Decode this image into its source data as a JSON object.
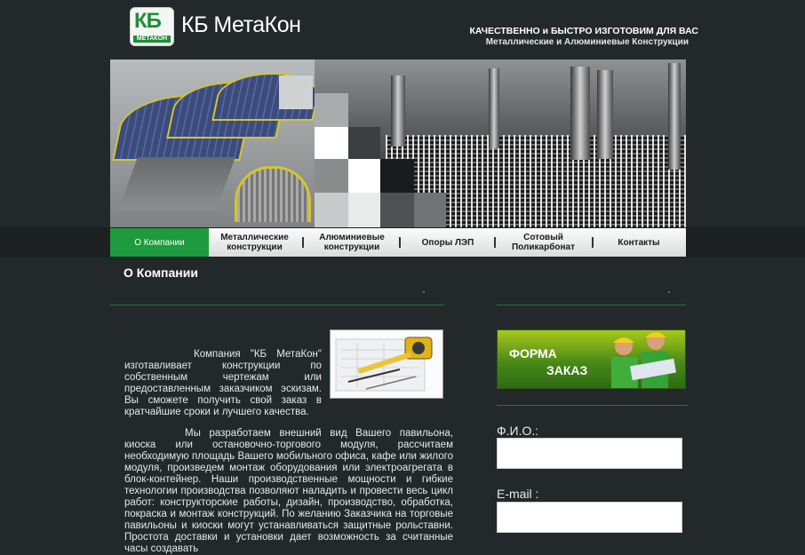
{
  "header": {
    "logo_letters": "КБ",
    "logo_subtext": "МЕТАКОН",
    "company_name": "КБ МетаКон",
    "tagline_line1": "КАЧЕСТВЕННО и БЫСТРО ИЗГОТОВИМ ДЛЯ ВАС",
    "tagline_line2": "Металлические и Алюминиевые Конструкции"
  },
  "nav": {
    "items": [
      {
        "label": "О Компании",
        "active": true
      },
      {
        "label": "Металлические конструкции",
        "active": false
      },
      {
        "label": "Алюминиевые конструкции",
        "active": false
      },
      {
        "label": "Опоры ЛЭП",
        "active": false
      },
      {
        "label": "Сотовый Поликарбонат",
        "active": false
      },
      {
        "label": "Контакты",
        "active": false
      }
    ]
  },
  "main": {
    "page_title": "О Компании",
    "paragraph1": "Компания \"КБ МетаКон\" изготавливает конструкции по собственным чертежам или предоставленным заказчиком эскизам. Вы сможете получить свой заказ в кратчайшие сроки и лучшего качества.",
    "paragraph2": "Мы разработаем внешний вид Вашего павильона, киоска или остановочно-торгового модуля, рассчитаем необходимую площадь Вашего мобильного офиса, кафе или жилого модуля, произведем монтаж оборудования или электроагрегата в блок-контейнер. Наши производственные мощности и гибкие технологии производства позволяют наладить и провести весь цикл работ: конструкторские работы, дизайн, производство, обработка, покраска и монтаж конструкций. По желанию Заказчика на торговые павильоны и киоски могут устанавливаться защитные рольставни. Простота доставки и установки дает возможность за считанные часы создавать"
  },
  "sidebar": {
    "order_banner_line1": "ФОРМА",
    "order_banner_line2": "ЗАКАЗ",
    "form": {
      "name_label": "Ф.И.О.:",
      "name_value": "",
      "email_label": "E-mail :",
      "email_value": ""
    }
  },
  "colors": {
    "background": "#23282a",
    "accent_green": "#1e9b3e",
    "divider_green": "#1f7a3a"
  }
}
